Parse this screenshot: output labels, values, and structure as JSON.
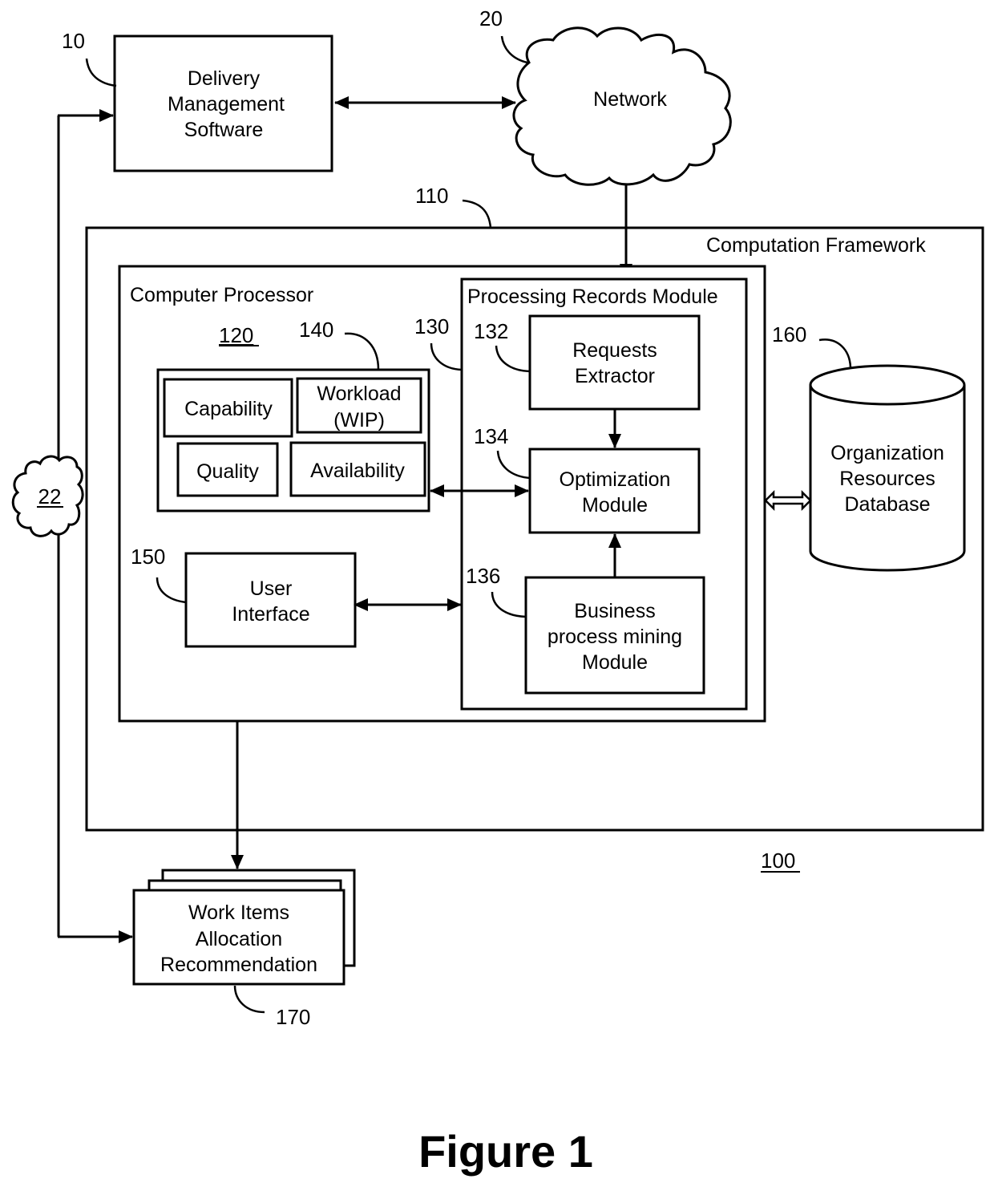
{
  "figure": {
    "caption": "Figure 1",
    "system_ref": "100"
  },
  "nodes": {
    "delivery_software": {
      "ref": "10",
      "lines": [
        "Delivery",
        "Management",
        "Software"
      ]
    },
    "network": {
      "ref": "20",
      "label": "Network"
    },
    "network_22": {
      "ref": "22"
    },
    "computation_framework": {
      "ref": "110",
      "label": "Computation Framework"
    },
    "computer_processor": {
      "ref": "120",
      "label": "Computer Processor"
    },
    "processing_records_module": {
      "ref": "130",
      "label": "Processing Records Module"
    },
    "requests_extractor": {
      "ref": "132",
      "lines": [
        "Requests",
        "Extractor"
      ]
    },
    "optimization_module": {
      "ref": "134",
      "lines": [
        "Optimization",
        "Module"
      ]
    },
    "business_process_mining": {
      "ref": "136",
      "lines": [
        "Business",
        "process mining",
        "Module"
      ]
    },
    "attributes_group": {
      "ref": "140",
      "items": {
        "capability": "Capability",
        "workload": [
          "Workload",
          "(WIP)"
        ],
        "quality": "Quality",
        "availability": "Availability"
      }
    },
    "user_interface": {
      "ref": "150",
      "lines": [
        "User",
        "Interface"
      ]
    },
    "resources_db": {
      "ref": "160",
      "lines": [
        "Organization",
        "Resources",
        "Database"
      ]
    },
    "work_items": {
      "ref": "170",
      "lines": [
        "Work Items",
        "Allocation",
        "Recommendation"
      ]
    }
  }
}
